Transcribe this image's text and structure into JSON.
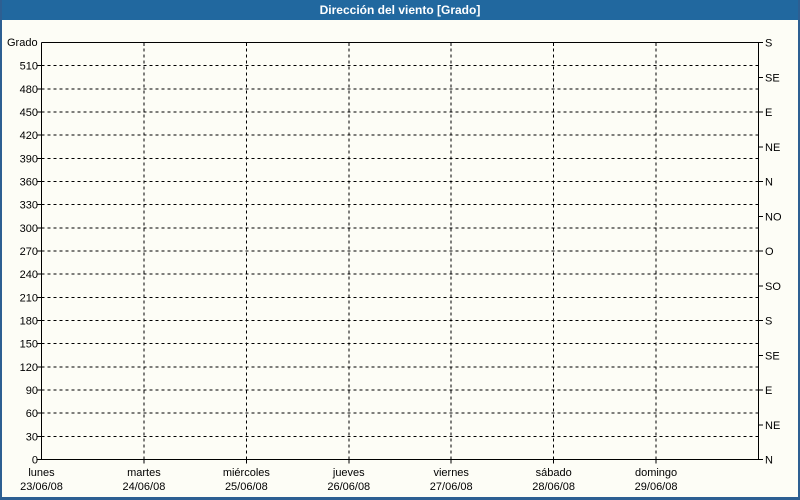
{
  "window": {
    "title": "Dirección del viento [Grado]"
  },
  "colors": {
    "titlebar_bg": "#21689f",
    "title_text": "#ffffff",
    "frame_border": "#2d5f92",
    "page_bg": "#fdfdf6",
    "grid": "#000000",
    "text": "#000000"
  },
  "chart_data": {
    "type": "line",
    "title": "Dirección del viento [Grado]",
    "ylabel": "Grado",
    "xlabel": "",
    "grid": true,
    "legend": false,
    "ylim": [
      0,
      540
    ],
    "left_axis": {
      "unit": "Grado",
      "tick_step": 30,
      "ticks": [
        0,
        30,
        60,
        90,
        120,
        150,
        180,
        210,
        240,
        270,
        300,
        330,
        360,
        390,
        420,
        450,
        480,
        510
      ]
    },
    "right_axis": {
      "tick_step": 45,
      "entries": [
        {
          "value": 540,
          "label": "S"
        },
        {
          "value": 495,
          "label": "SE"
        },
        {
          "value": 450,
          "label": "E"
        },
        {
          "value": 405,
          "label": "NE"
        },
        {
          "value": 360,
          "label": "N"
        },
        {
          "value": 315,
          "label": "NO"
        },
        {
          "value": 270,
          "label": "O"
        },
        {
          "value": 225,
          "label": "SO"
        },
        {
          "value": 180,
          "label": "S"
        },
        {
          "value": 135,
          "label": "SE"
        },
        {
          "value": 90,
          "label": "E"
        },
        {
          "value": 45,
          "label": "NE"
        },
        {
          "value": 0,
          "label": "N"
        }
      ]
    },
    "x_axis": {
      "days": [
        {
          "weekday": "lunes",
          "date": "23/06/08"
        },
        {
          "weekday": "martes",
          "date": "24/06/08"
        },
        {
          "weekday": "miércoles",
          "date": "25/06/08"
        },
        {
          "weekday": "jueves",
          "date": "26/06/08"
        },
        {
          "weekday": "viernes",
          "date": "27/06/08"
        },
        {
          "weekday": "sábado",
          "date": "28/06/08"
        },
        {
          "weekday": "domingo",
          "date": "29/06/08"
        }
      ]
    },
    "series": []
  }
}
